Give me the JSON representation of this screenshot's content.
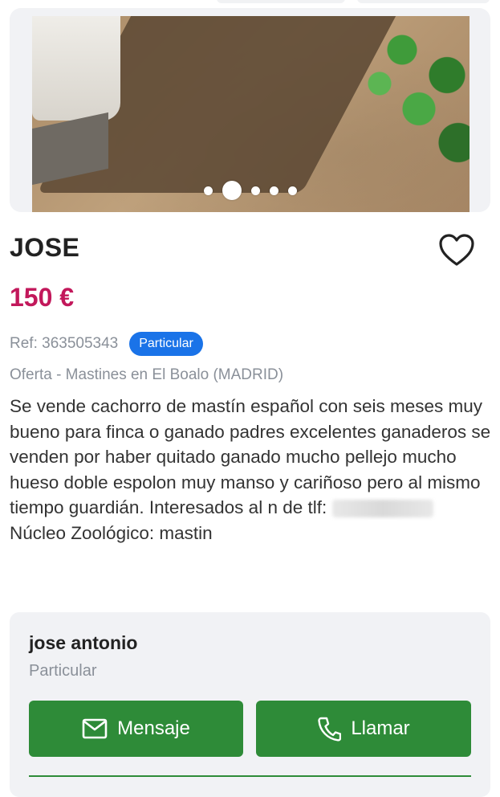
{
  "listing": {
    "title": "JOSE",
    "price": "150 €",
    "ref": "Ref: 363505343",
    "seller_badge": "Particular",
    "category": "Oferta - Mastines en El Boalo (MADRID)",
    "description_before_phone": "Se vende cachorro de mastín español con seis meses muy bueno para finca o ganado padres excelentes ganaderos se venden por haber quitado ganado mucho pellejo mucho hueso doble espolon muy manso y cariñoso pero al mismo tiempo guardián. Interesados al n de tlf: ",
    "description_after_phone": " Núcleo Zoológico: mastin"
  },
  "gallery": {
    "dot_count": 5,
    "active_dot": 1
  },
  "seller": {
    "name": "jose antonio",
    "type": "Particular",
    "message_label": "Mensaje",
    "call_label": "Llamar"
  },
  "colors": {
    "price": "#c2185b",
    "badge": "#1a73e8",
    "button": "#2e8b38"
  },
  "icons": {
    "favorite": "heart-outline-icon",
    "message": "envelope-icon",
    "call": "phone-icon"
  }
}
